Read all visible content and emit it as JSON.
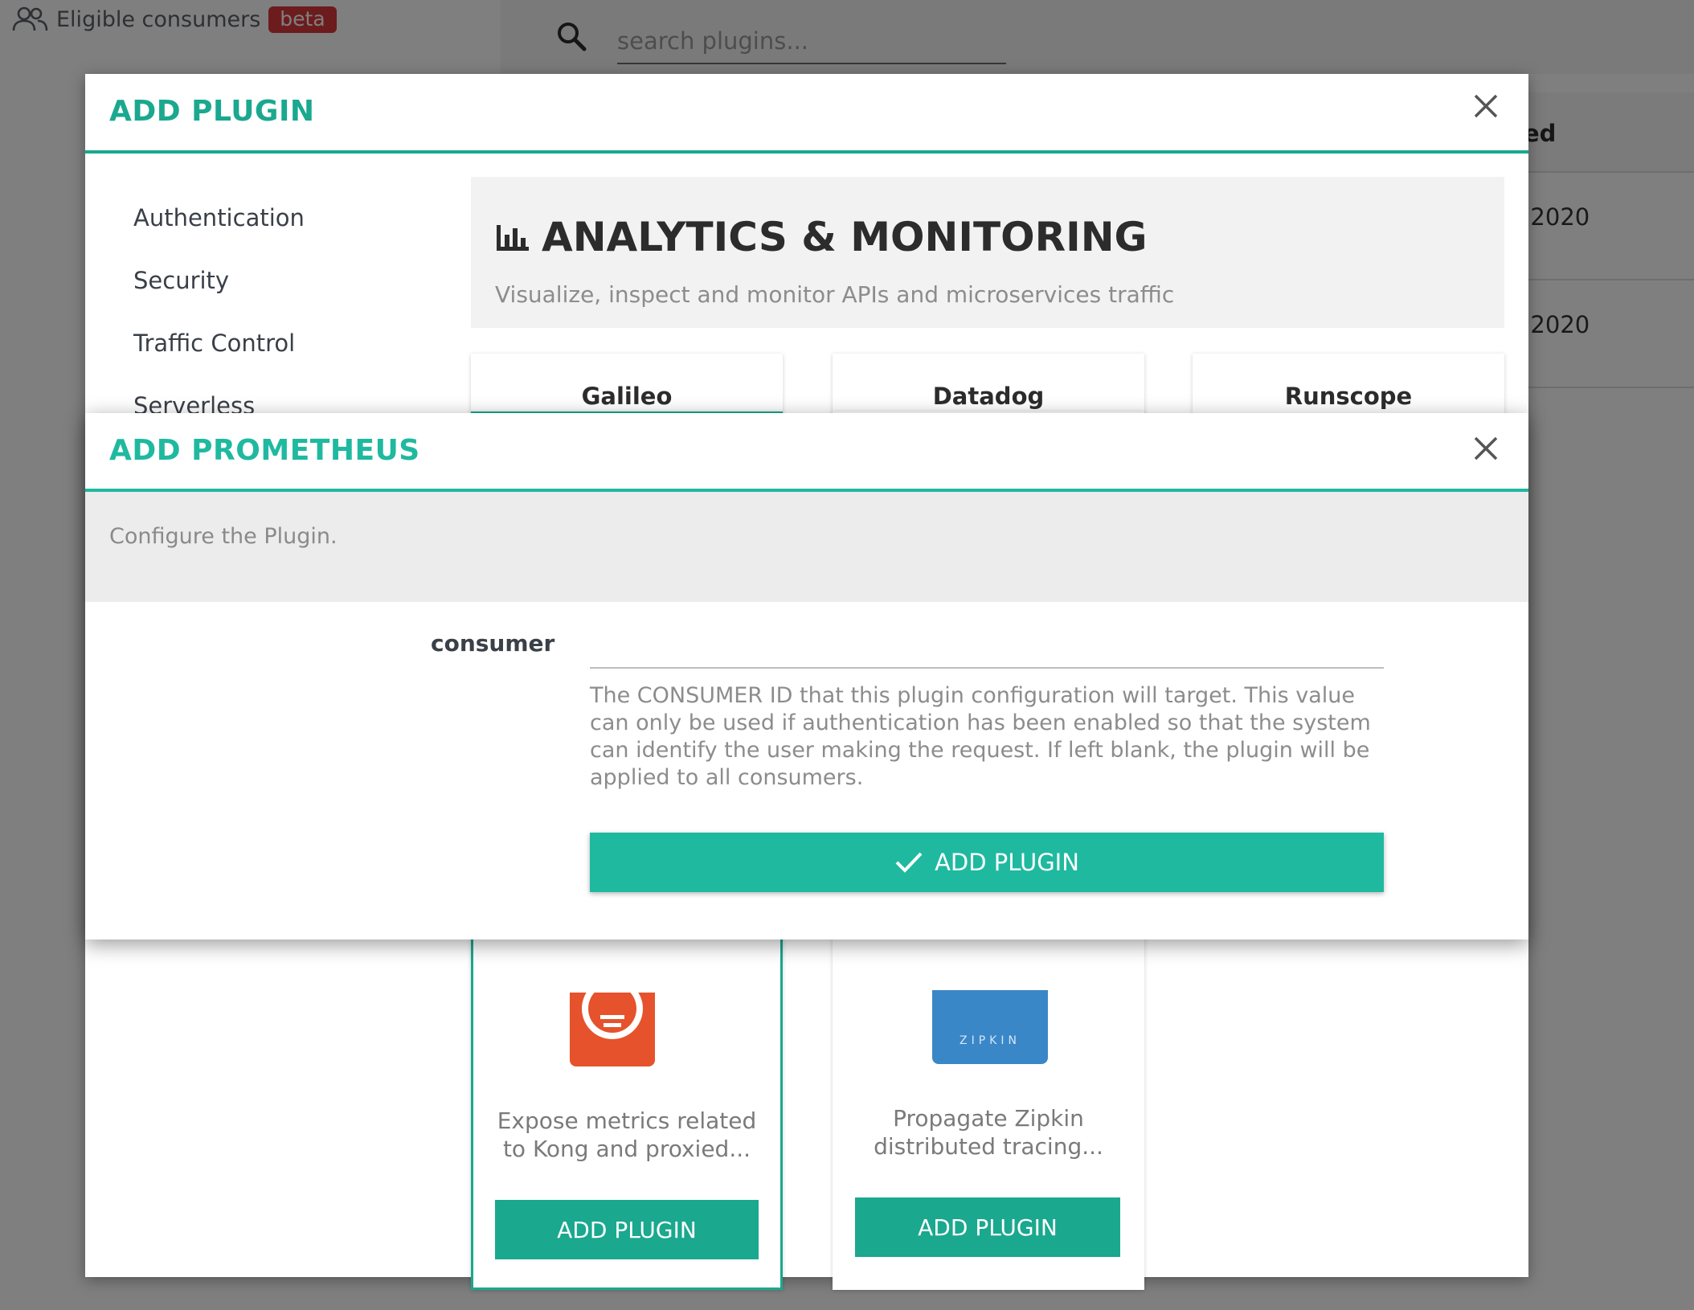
{
  "header": {
    "eligible_label": "Eligible consumers",
    "beta_badge": "beta",
    "search_placeholder": "search plugins..."
  },
  "background_table": {
    "column_header": "ed",
    "rows": [
      ", 2020",
      ", 2020"
    ]
  },
  "add_plugin_modal": {
    "title": "ADD PLUGIN",
    "categories": [
      "Authentication",
      "Security",
      "Traffic Control",
      "Serverless"
    ],
    "section_title": "ANALYTICS & MONITORING",
    "section_subtitle": "Visualize, inspect and monitor APIs and microservices traffic",
    "cards": [
      {
        "name": "Galileo"
      },
      {
        "name": "Datadog"
      },
      {
        "name": "Runscope"
      }
    ],
    "lower_cards": [
      {
        "description": "Expose metrics related to Kong and proxied...",
        "button": "ADD PLUGIN"
      },
      {
        "description": "Propagate Zipkin distributed tracing...",
        "button": "ADD PLUGIN",
        "logo_text": "ZIPKIN"
      }
    ]
  },
  "prometheus_modal": {
    "title": "ADD PROMETHEUS",
    "intro": "Configure the Plugin.",
    "field_label": "consumer",
    "field_value": "",
    "field_help": "The CONSUMER ID that this plugin configuration will target. This value can only be used if authentication has been enabled so that the system can identify the user making the request. If left blank, the plugin will be applied to all consumers.",
    "submit_label": "ADD PLUGIN"
  },
  "colors": {
    "accent": "#1fb9a0",
    "accent_dark": "#1aa88f",
    "beta": "#d9383a"
  }
}
